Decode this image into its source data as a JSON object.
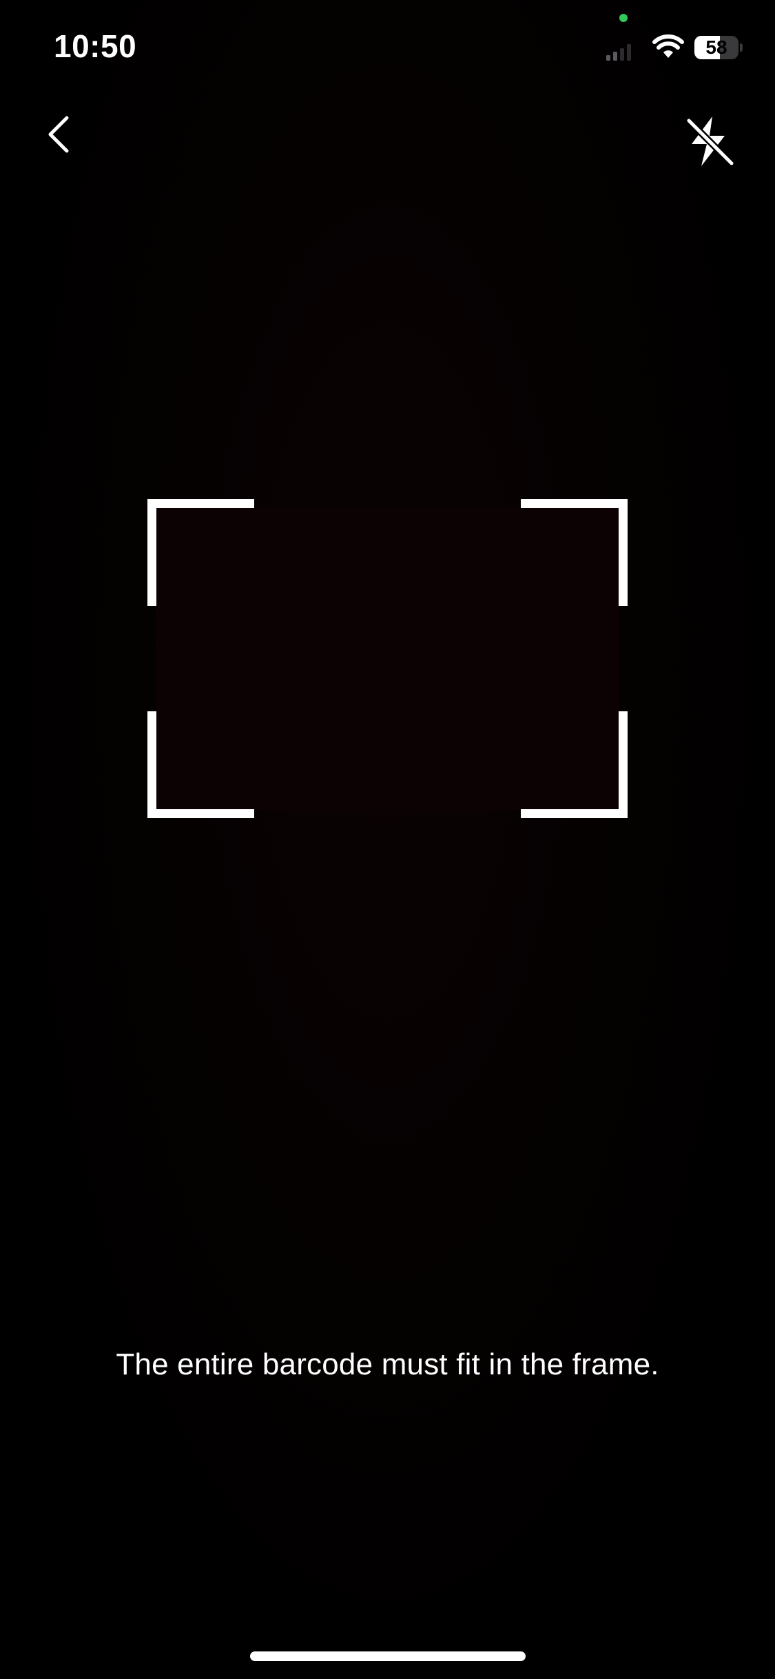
{
  "status_bar": {
    "time": "10:50",
    "battery_percent": "58",
    "battery_level": 0.58,
    "signal_icon": "cellular-signal-icon",
    "wifi_icon": "wifi-icon",
    "privacy_indicator_color": "#34c759"
  },
  "nav": {
    "back_icon": "chevron-left-icon",
    "flash_icon": "flash-off-icon"
  },
  "scanner": {
    "frame_color": "#ffffff",
    "hint": "The entire barcode must fit in the frame."
  }
}
